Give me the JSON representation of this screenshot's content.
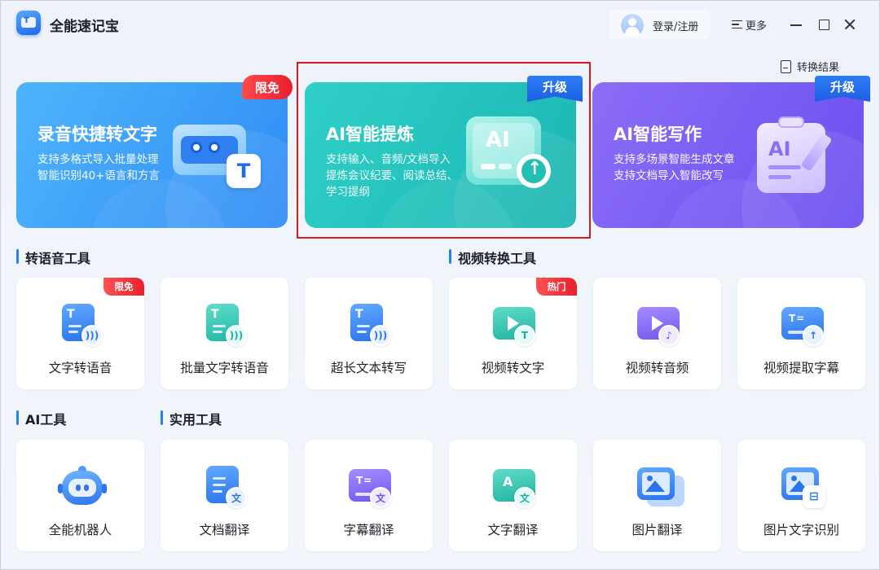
{
  "app": {
    "title": "全能速记宝"
  },
  "header": {
    "login_label": "登录/注册",
    "more_label": "更多",
    "convert_result_label": "转换结果"
  },
  "banners": [
    {
      "title": "录音快捷转文字",
      "desc1": "支持多格式导入批量处理",
      "desc2": "智能识别40+语言和方言",
      "desc3": "",
      "tag": "限免",
      "icon": "recorder-tape-icon"
    },
    {
      "title": "AI智能提炼",
      "desc1": "支持输入、音频/文档导入",
      "desc2": "提炼会议纪要、阅读总结、",
      "desc3": "学习提纲",
      "tag": "升级",
      "icon": "ai-screen-upload-icon"
    },
    {
      "title": "AI智能写作",
      "desc1": "支持多场景智能生成文章",
      "desc2": "支持文档导入智能改写",
      "desc3": "",
      "tag": "升级",
      "icon": "ai-paper-pen-icon"
    }
  ],
  "sections": {
    "voice_tools": "转语音工具",
    "video_tools": "视频转换工具",
    "ai_tools": "AI工具",
    "utility_tools": "实用工具"
  },
  "tools_row1": [
    {
      "label": "文字转语音",
      "tag": "限免",
      "icon": "text-to-speech-icon"
    },
    {
      "label": "批量文字转语音",
      "tag": "",
      "icon": "batch-text-to-speech-icon"
    },
    {
      "label": "超长文本转写",
      "tag": "",
      "icon": "long-text-transcribe-icon"
    },
    {
      "label": "视频转文字",
      "tag": "热门",
      "icon": "video-to-text-icon"
    },
    {
      "label": "视频转音频",
      "tag": "",
      "icon": "video-to-audio-icon"
    },
    {
      "label": "视频提取字幕",
      "tag": "",
      "icon": "video-subtitle-extract-icon"
    }
  ],
  "tools_row2": [
    {
      "label": "全能机器人",
      "icon": "robot-icon"
    },
    {
      "label": "文档翻译",
      "icon": "document-translate-icon"
    },
    {
      "label": "字幕翻译",
      "icon": "subtitle-translate-icon"
    },
    {
      "label": "文字翻译",
      "icon": "text-translate-icon"
    },
    {
      "label": "图片翻译",
      "icon": "image-translate-icon"
    },
    {
      "label": "图片文字识别",
      "icon": "image-ocr-icon"
    }
  ],
  "colors": {
    "accent": "#2b7ff3",
    "tag_red": "#e8202e",
    "highlight": "#d71920"
  }
}
